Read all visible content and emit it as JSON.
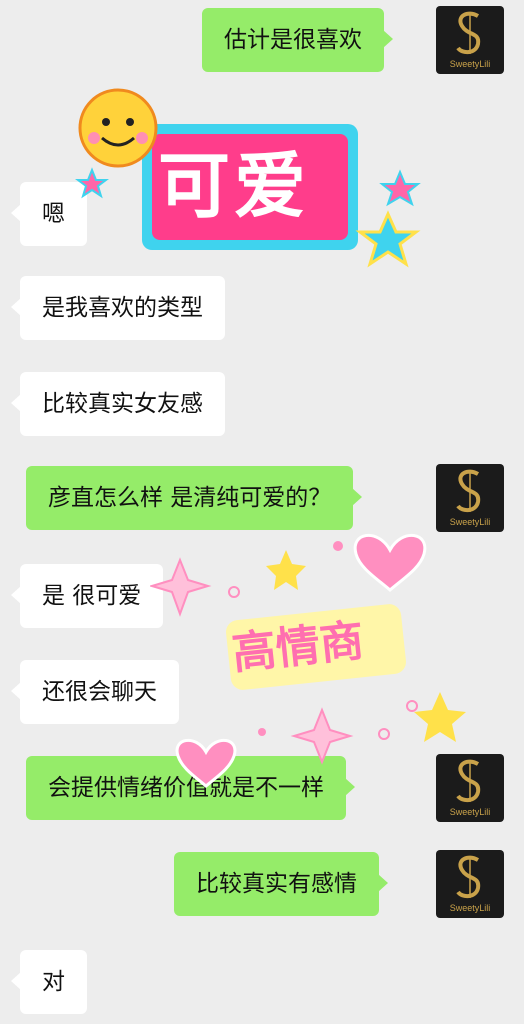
{
  "messages": [
    {
      "side": "out",
      "text": "估计是很喜欢"
    },
    {
      "side": "in",
      "text": "嗯"
    },
    {
      "side": "in",
      "text": "是我喜欢的类型"
    },
    {
      "side": "in",
      "text": "比较真实女友感"
    },
    {
      "side": "out",
      "text": "彦直怎么样 是清纯可爱的？"
    },
    {
      "side": "in",
      "text": "是 很可爱"
    },
    {
      "side": "in",
      "text": "还很会聊天"
    },
    {
      "side": "out",
      "text": "会提供情绪价值就是不一样"
    },
    {
      "side": "out",
      "text": "比较真实有感情"
    },
    {
      "side": "in",
      "text": "对"
    }
  ],
  "avatar": {
    "brand": "SweetyLili"
  },
  "stickers": {
    "cute": "可爱",
    "high_eq": "高情商"
  },
  "colors": {
    "background": "#ededed",
    "incoming_bubble": "#ffffff",
    "outgoing_bubble": "#95ec69",
    "avatar_bg": "#1b1b1b",
    "avatar_gold": "#c9a24a"
  }
}
